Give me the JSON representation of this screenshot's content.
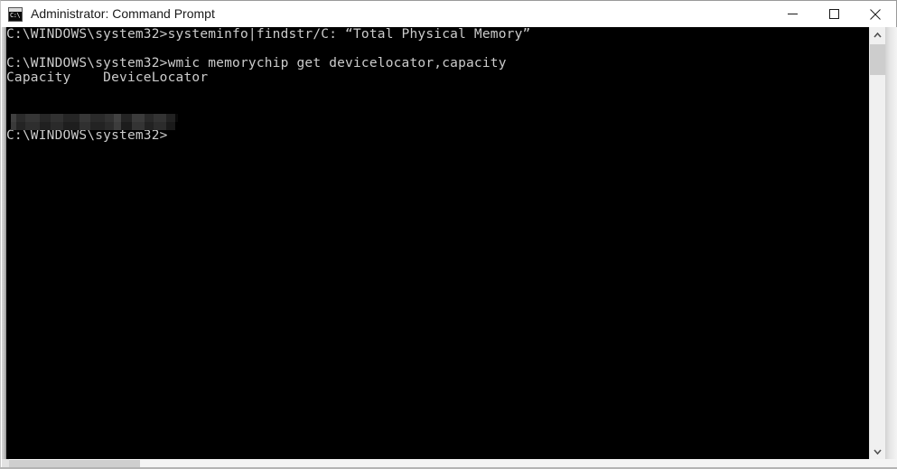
{
  "window": {
    "title": "Administrator: Command Prompt",
    "icon_name": "cmd-console-icon",
    "icon_glyph": "C:\\",
    "background_color": "#000000",
    "titlebar_color": "#ffffff",
    "text_color": "#cccccc"
  },
  "controls": {
    "minimize_label": "—",
    "maximize_label": "□",
    "close_label": "✕"
  },
  "console": {
    "lines": [
      "C:\\WINDOWS\\system32>systeminfo|findstr/C: “Total Physical Memory”",
      "",
      "C:\\WINDOWS\\system32>wmic memorychip get devicelocator,capacity",
      "Capacity    DeviceLocator",
      "",
      "",
      "",
      "C:\\WINDOWS\\system32>"
    ],
    "prompt": "C:\\WINDOWS\\system32>",
    "commands": [
      "systeminfo|findstr/C: “Total Physical Memory”",
      "wmic memorychip get devicelocator,capacity"
    ],
    "output_headers": [
      "Capacity",
      "DeviceLocator"
    ],
    "redacted_row_note": "blurred output row"
  },
  "scrollbars": {
    "vertical": {
      "up_arrow": "▲",
      "down_arrow": "▼",
      "thumb_color": "#cdcdcd",
      "track_color": "#f0f0f0"
    },
    "horizontal": {
      "thumb_color": "#cfcfcf",
      "track_color": "#f4f4f4"
    }
  }
}
